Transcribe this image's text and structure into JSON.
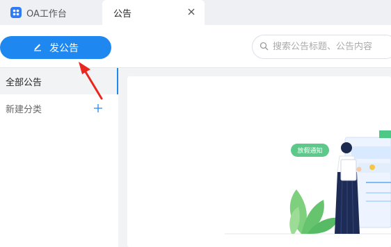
{
  "tabs": [
    {
      "label": "OA工作台",
      "active": false
    },
    {
      "label": "公告",
      "active": true
    }
  ],
  "toolbar": {
    "publish_label": "发公告",
    "search_placeholder": "搜索公告标题、公告内容"
  },
  "sidebar": {
    "all_label": "全部公告",
    "new_category_label": "新建分类"
  },
  "illustration": {
    "badge_text": "放假通知"
  },
  "colors": {
    "primary": "#1e88f0",
    "annotation_arrow": "#e8281e",
    "badge": "#5cc98a"
  }
}
